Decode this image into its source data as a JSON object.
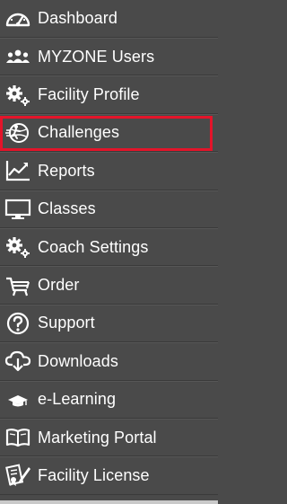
{
  "sidebar": {
    "items": [
      {
        "label": "Dashboard",
        "icon": "dashboard-gauge-icon"
      },
      {
        "label": "MYZONE Users",
        "icon": "users-group-icon"
      },
      {
        "label": "Facility Profile",
        "icon": "gears-icon"
      },
      {
        "label": "Challenges",
        "icon": "running-globe-icon",
        "active": true
      },
      {
        "label": "Reports",
        "icon": "line-chart-icon"
      },
      {
        "label": "Classes",
        "icon": "monitor-icon"
      },
      {
        "label": "Coach Settings",
        "icon": "gears-icon"
      },
      {
        "label": "Order",
        "icon": "shopping-cart-icon"
      },
      {
        "label": "Support",
        "icon": "question-circle-icon"
      },
      {
        "label": "Downloads",
        "icon": "cloud-download-icon"
      },
      {
        "label": "e-Learning",
        "icon": "graduation-cap-icon"
      },
      {
        "label": "Marketing Portal",
        "icon": "open-book-icon"
      },
      {
        "label": "Facility License",
        "icon": "certificate-pen-icon"
      }
    ]
  },
  "colors": {
    "background": "#4a4a4a",
    "text": "#ffffff",
    "active_border": "#e4142a"
  }
}
